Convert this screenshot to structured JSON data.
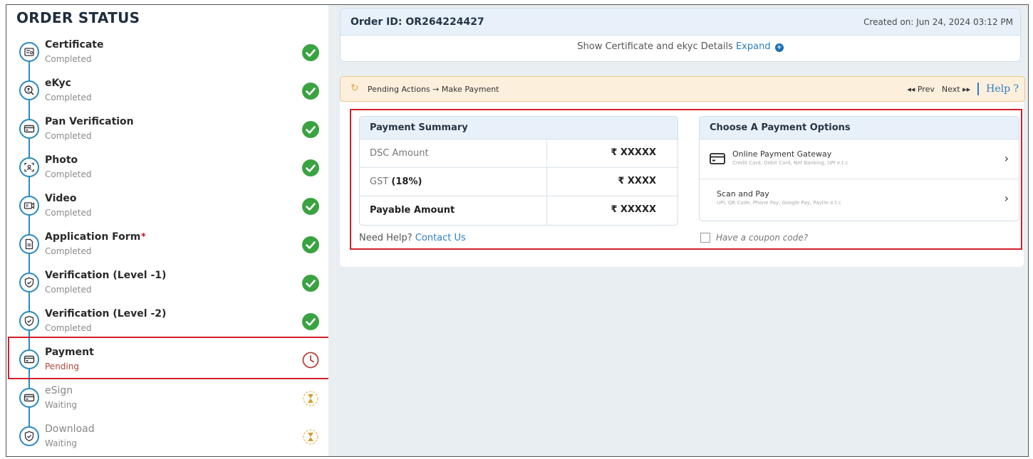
{
  "sidebar": {
    "title": "ORDER STATUS",
    "steps": [
      {
        "name": "Certificate",
        "status": "Completed",
        "icon": "certificate-icon",
        "state": "done"
      },
      {
        "name": "eKyc",
        "status": "Completed",
        "icon": "search-person-icon",
        "state": "done"
      },
      {
        "name": "Pan Verification",
        "status": "Completed",
        "icon": "card-icon",
        "state": "done"
      },
      {
        "name": "Photo",
        "status": "Completed",
        "icon": "photo-icon",
        "state": "done"
      },
      {
        "name": "Video",
        "status": "Completed",
        "icon": "video-icon",
        "state": "done"
      },
      {
        "name": "Application Form",
        "status": "Completed",
        "icon": "document-icon",
        "state": "done",
        "required_mark": "*"
      },
      {
        "name": "Verification (Level -1)",
        "status": "Completed",
        "icon": "shield-icon",
        "state": "done"
      },
      {
        "name": "Verification (Level -2)",
        "status": "Completed",
        "icon": "shield-icon",
        "state": "done"
      },
      {
        "name": "Payment",
        "status": "Pending",
        "icon": "card-icon",
        "state": "pending"
      },
      {
        "name": "eSign",
        "status": "Waiting",
        "icon": "card-icon",
        "state": "waiting"
      },
      {
        "name": "Download",
        "status": "Waiting",
        "icon": "shield-icon",
        "state": "waiting"
      }
    ]
  },
  "order": {
    "id_label": "Order ID: OR264224427",
    "created": "Created on: Jun 24, 2024 03:12 PM",
    "cert_text": "Show Certificate and ekyc Details",
    "expand": "Expand"
  },
  "pending": {
    "text": "Pending Actions → Make Payment",
    "prev": "Prev",
    "next": "Next",
    "help": "Help ?"
  },
  "summary": {
    "header": "Payment Summary",
    "rows": [
      {
        "label": "DSC Amount",
        "value": "₹ XXXXX"
      },
      {
        "label_pre": "GST ",
        "label_bold": "(18%)",
        "value": "₹ XXXX"
      },
      {
        "label": "Payable Amount",
        "value": "₹ XXXXX"
      }
    ],
    "need_help": "Need Help?",
    "contact": "Contact Us"
  },
  "options": {
    "header": "Choose A Payment Options",
    "items": [
      {
        "title": "Online Payment Gateway",
        "sub": "Credit Card, Debit Card, Net Banking, UPI e.t.c"
      },
      {
        "title": "Scan and Pay",
        "sub": "UPI, QR Code, Phone Pay, Google Pay, Paytm e.t.c"
      }
    ],
    "coupon": "Have a coupon code?"
  },
  "colors": {
    "accent": "#2b8ac0",
    "done": "#3aa341",
    "pending": "#b0443a",
    "highlight": "#d21f2b"
  }
}
